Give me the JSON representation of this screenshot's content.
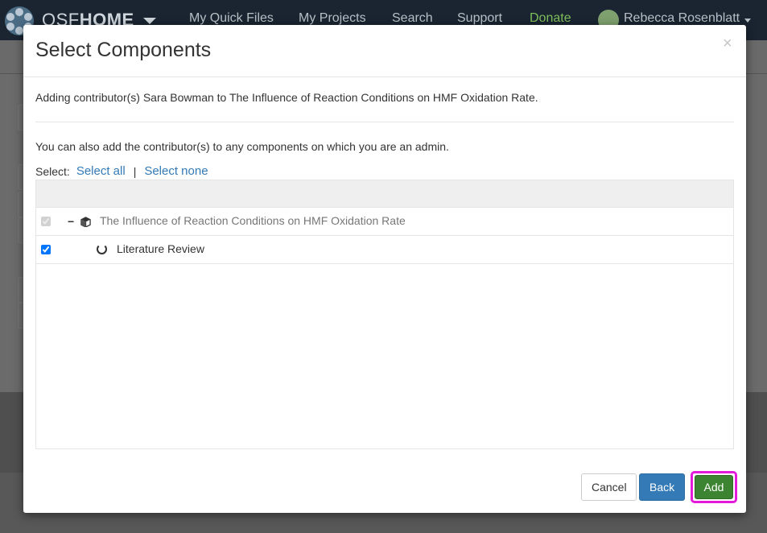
{
  "navbar": {
    "brand_thin": "OSF",
    "brand_bold": "HOME",
    "links": [
      "My Quick Files",
      "My Projects",
      "Search",
      "Support",
      "Donate"
    ],
    "user": "Rebecca Rosenblatt"
  },
  "modal": {
    "title": "Select Components",
    "close": "×",
    "intro": "Adding contributor(s) Sara Bowman to The Influence of Reaction Conditions on HMF Oxidation Rate.",
    "admin_note": "You can also add the contributor(s) to any components on which you are an admin.",
    "select_label": "Select:",
    "select_all": "Select all",
    "separator": "|",
    "select_none": "Select none",
    "tree": [
      {
        "title": "The Influence of Reaction Conditions on HMF Oxidation Rate",
        "checked": true,
        "disabled": true,
        "toggle": "−",
        "icon": "project-cube-icon"
      },
      {
        "title": "Literature Review",
        "checked": true,
        "disabled": false,
        "icon": "component-circle-icon"
      }
    ],
    "buttons": {
      "cancel": "Cancel",
      "back": "Back",
      "add": "Add"
    },
    "colors": {
      "primary": "#337ab7",
      "success": "#3c8431",
      "highlight": "#e31ad9"
    }
  }
}
